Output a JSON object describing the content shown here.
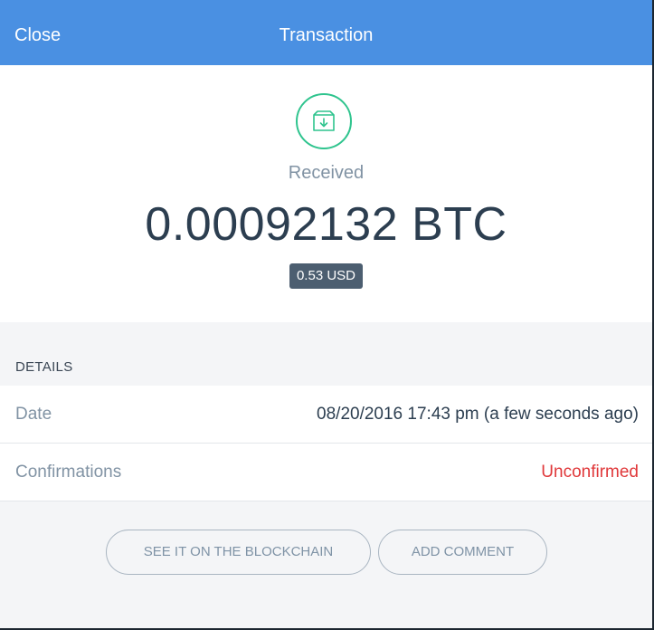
{
  "header": {
    "close_label": "Close",
    "title": "Transaction"
  },
  "transaction": {
    "icon": "received-box-icon",
    "status": "Received",
    "amount": "0.00092132 BTC",
    "fiat": "0.53 USD"
  },
  "details": {
    "heading": "DETAILS",
    "rows": [
      {
        "label": "Date",
        "value": "08/20/2016 17:43 pm (a few seconds ago)"
      },
      {
        "label": "Confirmations",
        "value": "Unconfirmed"
      }
    ]
  },
  "actions": {
    "blockchain_label": "SEE IT ON THE BLOCKCHAIN",
    "comment_label": "ADD COMMENT"
  },
  "colors": {
    "header": "#4a90e2",
    "received_accent": "#2fc48e",
    "unconfirmed": "#e0383a"
  }
}
